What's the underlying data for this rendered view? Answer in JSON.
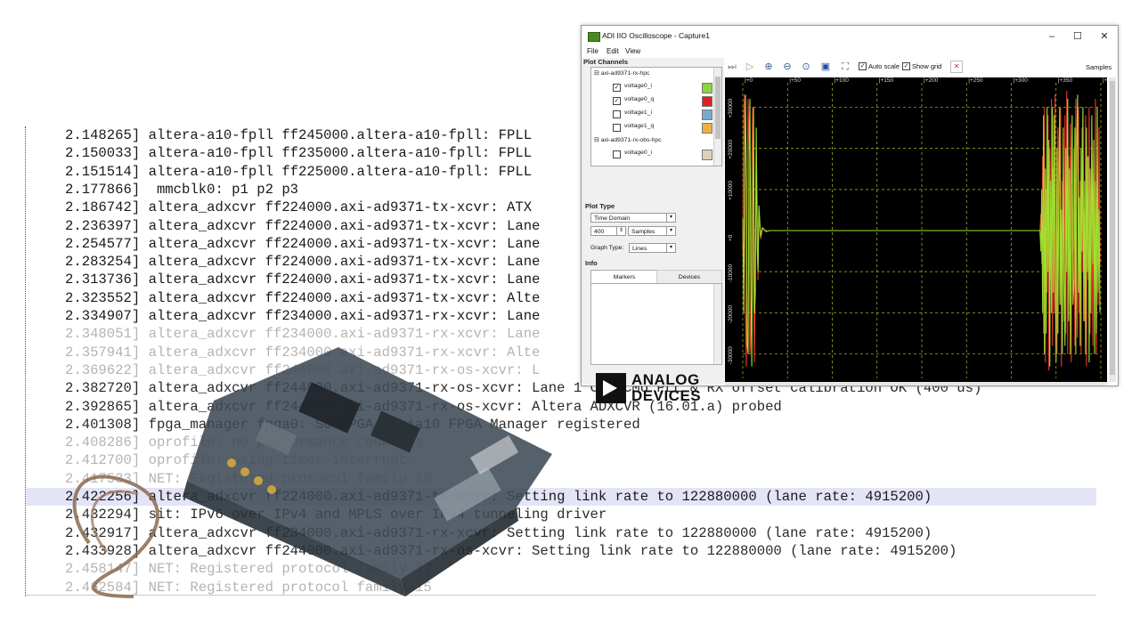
{
  "log": {
    "lines": [
      {
        "ts": "2.148265]",
        "msg": "altera-a10-fpll ff245000.altera-a10-fpll: FPLL",
        "style": "normal"
      },
      {
        "ts": "2.150033]",
        "msg": "altera-a10-fpll ff235000.altera-a10-fpll: FPLL",
        "style": "normal"
      },
      {
        "ts": "2.151514]",
        "msg": "altera-a10-fpll ff225000.altera-a10-fpll: FPLL",
        "style": "normal"
      },
      {
        "ts": "2.177866]",
        "msg": " mmcblk0: p1 p2 p3",
        "style": "normal"
      },
      {
        "ts": "2.186742]",
        "msg": "altera_adxcvr ff224000.axi-ad9371-tx-xcvr: ATX",
        "style": "normal"
      },
      {
        "ts": "2.236397]",
        "msg": "altera_adxcvr ff224000.axi-ad9371-tx-xcvr: Lane",
        "style": "normal"
      },
      {
        "ts": "2.254577]",
        "msg": "altera_adxcvr ff224000.axi-ad9371-tx-xcvr: Lane",
        "style": "normal"
      },
      {
        "ts": "2.283254]",
        "msg": "altera_adxcvr ff224000.axi-ad9371-tx-xcvr: Lane",
        "style": "normal"
      },
      {
        "ts": "2.313736]",
        "msg": "altera_adxcvr ff224000.axi-ad9371-tx-xcvr: Lane",
        "style": "normal"
      },
      {
        "ts": "2.323552]",
        "msg": "altera_adxcvr ff224000.axi-ad9371-tx-xcvr: Alte",
        "style": "normal"
      },
      {
        "ts": "2.334907]",
        "msg": "altera_adxcvr ff234000.axi-ad9371-rx-xcvr: Lane",
        "style": "normal"
      },
      {
        "ts": "2.348051]",
        "msg": "altera_adxcvr ff234000.axi-ad9371-rx-xcvr: Lane",
        "style": "faded"
      },
      {
        "ts": "2.357941]",
        "msg": "altera_adxcvr ff234000.axi-ad9371-rx-xcvr: Alte",
        "style": "faded"
      },
      {
        "ts": "2.369622]",
        "msg": "altera_adxcvr ff244000.axi-ad9371-rx-os-xcvr: L",
        "style": "faded"
      },
      {
        "ts": "2.382720]",
        "msg": "altera_adxcvr ff244000.axi-ad9371-rx-os-xcvr: Lane 1 CDR/CMU PLL & RX offset calibration OK (400 us)",
        "style": "mid"
      },
      {
        "ts": "2.392865]",
        "msg": "altera_adxcvr ff244000.axi-ad9371-rx-os-xcvr: Altera ADXCVR (16.01.a) probed",
        "style": "mid"
      },
      {
        "ts": "2.401308]",
        "msg": "fpga_manager fpga0: SoCFPGA Arria10 FPGA Manager registered",
        "style": "mid"
      },
      {
        "ts": "2.408286]",
        "msg": "oprofile: no performance counters",
        "style": "faded"
      },
      {
        "ts": "2.412700]",
        "msg": "oprofile: using timer interrupt.",
        "style": "faded"
      },
      {
        "ts": "2.417533]",
        "msg": "NET: Registered protocol family 10",
        "style": "faded"
      },
      {
        "ts": "2.422256]",
        "msg": "altera_adxcvr ff224000.axi-ad9371-tx-xcvr: Setting link rate to 122880000 (lane rate: 4915200)",
        "style": "highlight"
      },
      {
        "ts": "2.432294]",
        "msg": "sit: IPv6 over IPv4 and MPLS over IPv4 tunneling driver",
        "style": "mid"
      },
      {
        "ts": "2.432917]",
        "msg": "altera_adxcvr ff234000.axi-ad9371-rx-xcvr: Setting link rate to 122880000 (lane rate: 4915200)",
        "style": "mid"
      },
      {
        "ts": "2.433928]",
        "msg": "altera_adxcvr ff244000.axi-ad9371-rx-os-xcvr: Setting link rate to 122880000 (lane rate: 4915200)",
        "style": "mid"
      },
      {
        "ts": "2.458147]",
        "msg": "NET: Registered protocol family 17",
        "style": "faded"
      },
      {
        "ts": "2.462584]",
        "msg": "NET: Registered protocol family 15",
        "style": "faded"
      }
    ]
  },
  "scope": {
    "title": "ADI IIO Oscilloscope - Capture1",
    "window_buttons": {
      "minimize": "–",
      "maximize": "☐",
      "close": "✕"
    },
    "menu": {
      "file": "File",
      "edit": "Edit",
      "view": "View"
    },
    "plot_channels_label": "Plot Channels",
    "devices": [
      {
        "name": "axi-ad9371-rx-hpc",
        "channels": [
          {
            "name": "voltage0_i",
            "checked": true,
            "color": "#8ed43c"
          },
          {
            "name": "voltage0_q",
            "checked": true,
            "color": "#e02020"
          },
          {
            "name": "voltage1_i",
            "checked": false,
            "color": "#7aaac8"
          },
          {
            "name": "voltage1_q",
            "checked": false,
            "color": "#f0b040"
          }
        ]
      },
      {
        "name": "axi-ad9371-rx-obs-hpc",
        "channels": [
          {
            "name": "voltage0_i",
            "checked": false,
            "color": "#dcd4b8"
          }
        ]
      }
    ],
    "plot_type_label": "Plot Type",
    "plot_type_value": "Time Domain",
    "samples_value": "400",
    "samples_unit": "Samples",
    "graph_type_label": "Graph Type:",
    "graph_type_value": "Lines",
    "info_label": "Info",
    "tabs": {
      "markers": "Markers",
      "devices": "Devices"
    },
    "logo_line1": "ANALOG",
    "logo_line2": "DEVICES",
    "toolbar": {
      "auto_scale": "Auto scale",
      "show_grid": "Show grid",
      "samples": "Samples",
      "auto_scale_checked": true,
      "show_grid_checked": true
    }
  },
  "chart_data": {
    "type": "line",
    "x_ticks": [
      "0",
      "50",
      "100",
      "150",
      "200",
      "250",
      "300",
      "350",
      "400"
    ],
    "y_ticks": [
      "30000",
      "20000",
      "10000",
      "0",
      "-10000",
      "-20000",
      "-30000"
    ],
    "xlim": [
      0,
      400
    ],
    "ylim": [
      -36000,
      36000
    ],
    "grid": true,
    "series": [
      {
        "color": "#e83a2a",
        "x": [
          0,
          1,
          2,
          3,
          4,
          5,
          6,
          7,
          8,
          9,
          10,
          11,
          12,
          13,
          14,
          15,
          16,
          17,
          18,
          20,
          22,
          26,
          30,
          60,
          100,
          200,
          300,
          320,
          332,
          333,
          334,
          335,
          336,
          337,
          338,
          339,
          340,
          341,
          342,
          343,
          344,
          345,
          346,
          347,
          348,
          349,
          350,
          351,
          352,
          353,
          354,
          355,
          356,
          357,
          358,
          359,
          360,
          361,
          362,
          363,
          364,
          365,
          366,
          367,
          368,
          369,
          370,
          371,
          372,
          373,
          374,
          375,
          376,
          377,
          378,
          379,
          380,
          381,
          382,
          383,
          384,
          385,
          386,
          387,
          388,
          389,
          390,
          391,
          392,
          393,
          394,
          395,
          396,
          397,
          398,
          399
        ],
        "y": [
          -5000,
          28000,
          33000,
          -20000,
          -33000,
          10000,
          32000,
          20000,
          -30000,
          -25000,
          15000,
          30000,
          -10000,
          -32000,
          -8000,
          20000,
          8000,
          -12000,
          4000,
          -2000,
          800,
          -300,
          0,
          0,
          0,
          0,
          0,
          0,
          0,
          4000,
          -8000,
          18000,
          -25000,
          30000,
          -32000,
          10000,
          -15000,
          28000,
          -34000,
          20000,
          -5000,
          32000,
          -28000,
          15000,
          -20000,
          33000,
          -10000,
          -30000,
          25000,
          5000,
          -18000,
          30000,
          -33000,
          12000,
          8000,
          -22000,
          28000,
          -25000,
          34000,
          -30000,
          18000,
          -8000,
          26000,
          -32000,
          10000,
          -5000,
          20000,
          -28000,
          32000,
          -15000,
          -26000,
          30000,
          -20000,
          12000,
          -30000,
          25000,
          -10000,
          5000,
          -22000,
          28000,
          -33000,
          18000,
          -12000,
          30000,
          -25000,
          8000,
          20000,
          -28000,
          15000,
          -5000,
          32000,
          -30000,
          10000,
          -18000,
          25000,
          -8000
        ]
      },
      {
        "color": "#9fe030",
        "x": [
          0,
          1,
          2,
          3,
          4,
          5,
          6,
          7,
          8,
          9,
          10,
          11,
          12,
          13,
          14,
          15,
          16,
          17,
          18,
          20,
          22,
          26,
          30,
          60,
          100,
          200,
          300,
          320,
          332,
          333,
          334,
          335,
          336,
          337,
          338,
          339,
          340,
          341,
          342,
          343,
          344,
          345,
          346,
          347,
          348,
          349,
          350,
          351,
          352,
          353,
          354,
          355,
          356,
          357,
          358,
          359,
          360,
          361,
          362,
          363,
          364,
          365,
          366,
          367,
          368,
          369,
          370,
          371,
          372,
          373,
          374,
          375,
          376,
          377,
          378,
          379,
          380,
          381,
          382,
          383,
          384,
          385,
          386,
          387,
          388,
          389,
          390,
          391,
          392,
          393,
          394,
          395,
          396,
          397,
          398,
          399
        ],
        "y": [
          3000,
          -20000,
          15000,
          33000,
          10000,
          -28000,
          -30000,
          18000,
          32000,
          -10000,
          -33000,
          5000,
          30000,
          -20000,
          -15000,
          25000,
          -4000,
          -10000,
          6000,
          -1500,
          600,
          -200,
          0,
          0,
          0,
          0,
          0,
          0,
          0,
          -5000,
          10000,
          -20000,
          28000,
          -30000,
          15000,
          -25000,
          30000,
          -10000,
          22000,
          -33000,
          12000,
          -20000,
          30000,
          -15000,
          28000,
          -8000,
          -32000,
          20000,
          -25000,
          10000,
          30000,
          -18000,
          5000,
          -30000,
          25000,
          -12000,
          -28000,
          20000,
          -10000,
          32000,
          -22000,
          15000,
          -30000,
          8000,
          28000,
          -18000,
          -12000,
          25000,
          -30000,
          20000,
          33000,
          -15000,
          8000,
          -28000,
          20000,
          -5000,
          30000,
          -22000,
          12000,
          -30000,
          25000,
          -10000,
          18000,
          -32000,
          15000,
          -20000,
          28000,
          -8000,
          22000,
          -30000,
          12000,
          -25000,
          30000,
          -15000,
          5000,
          -20000
        ]
      }
    ]
  }
}
